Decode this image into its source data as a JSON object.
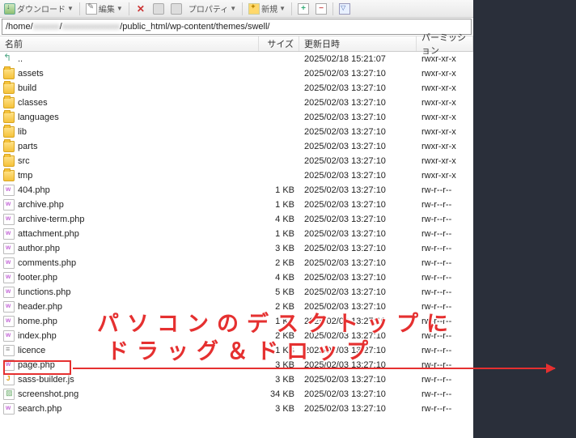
{
  "toolbar": {
    "download": "ダウンロード",
    "edit": "編集",
    "properties": "プロパティ",
    "new": "新規"
  },
  "path": {
    "prefix": "/home/",
    "blur1": "xxxxxx",
    "sep1": "/",
    "blur2": "xxxxxxxxxxxxx",
    "suffix": "/public_html/wp-content/themes/swell/"
  },
  "columns": {
    "name": "名前",
    "size": "サイズ",
    "date": "更新日時",
    "perm": "パーミッション"
  },
  "files": [
    {
      "icon": "up",
      "name": "..",
      "size": "",
      "date": "2025/02/18 15:21:07",
      "perm": "rwxr-xr-x"
    },
    {
      "icon": "folder",
      "name": "assets",
      "size": "",
      "date": "2025/02/03 13:27:10",
      "perm": "rwxr-xr-x"
    },
    {
      "icon": "folder",
      "name": "build",
      "size": "",
      "date": "2025/02/03 13:27:10",
      "perm": "rwxr-xr-x"
    },
    {
      "icon": "folder",
      "name": "classes",
      "size": "",
      "date": "2025/02/03 13:27:10",
      "perm": "rwxr-xr-x"
    },
    {
      "icon": "folder",
      "name": "languages",
      "size": "",
      "date": "2025/02/03 13:27:10",
      "perm": "rwxr-xr-x"
    },
    {
      "icon": "folder",
      "name": "lib",
      "size": "",
      "date": "2025/02/03 13:27:10",
      "perm": "rwxr-xr-x"
    },
    {
      "icon": "folder",
      "name": "parts",
      "size": "",
      "date": "2025/02/03 13:27:10",
      "perm": "rwxr-xr-x"
    },
    {
      "icon": "folder",
      "name": "src",
      "size": "",
      "date": "2025/02/03 13:27:10",
      "perm": "rwxr-xr-x"
    },
    {
      "icon": "folder",
      "name": "tmp",
      "size": "",
      "date": "2025/02/03 13:27:10",
      "perm": "rwxr-xr-x"
    },
    {
      "icon": "php",
      "name": "404.php",
      "size": "1 KB",
      "date": "2025/02/03 13:27:10",
      "perm": "rw-r--r--"
    },
    {
      "icon": "php",
      "name": "archive.php",
      "size": "1 KB",
      "date": "2025/02/03 13:27:10",
      "perm": "rw-r--r--"
    },
    {
      "icon": "php",
      "name": "archive-term.php",
      "size": "4 KB",
      "date": "2025/02/03 13:27:10",
      "perm": "rw-r--r--"
    },
    {
      "icon": "php",
      "name": "attachment.php",
      "size": "1 KB",
      "date": "2025/02/03 13:27:10",
      "perm": "rw-r--r--"
    },
    {
      "icon": "php",
      "name": "author.php",
      "size": "3 KB",
      "date": "2025/02/03 13:27:10",
      "perm": "rw-r--r--"
    },
    {
      "icon": "php",
      "name": "comments.php",
      "size": "2 KB",
      "date": "2025/02/03 13:27:10",
      "perm": "rw-r--r--"
    },
    {
      "icon": "php",
      "name": "footer.php",
      "size": "4 KB",
      "date": "2025/02/03 13:27:10",
      "perm": "rw-r--r--"
    },
    {
      "icon": "php",
      "name": "functions.php",
      "size": "5 KB",
      "date": "2025/02/03 13:27:10",
      "perm": "rw-r--r--"
    },
    {
      "icon": "php",
      "name": "header.php",
      "size": "2 KB",
      "date": "2025/02/03 13:27:10",
      "perm": "rw-r--r--"
    },
    {
      "icon": "php",
      "name": "home.php",
      "size": "1 KB",
      "date": "2025/02/03 13:27:10",
      "perm": "rw-r--r--"
    },
    {
      "icon": "php",
      "name": "index.php",
      "size": "2 KB",
      "date": "2025/02/03 13:27:10",
      "perm": "rw-r--r--"
    },
    {
      "icon": "txt",
      "name": "licence",
      "size": "1 KB",
      "date": "2025/02/03 13:27:10",
      "perm": "rw-r--r--"
    },
    {
      "icon": "php",
      "name": "page.php",
      "size": "3 KB",
      "date": "2025/02/03 13:27:10",
      "perm": "rw-r--r--"
    },
    {
      "icon": "js",
      "name": "sass-builder.js",
      "size": "3 KB",
      "date": "2025/02/03 13:27:10",
      "perm": "rw-r--r--"
    },
    {
      "icon": "png",
      "name": "screenshot.png",
      "size": "34 KB",
      "date": "2025/02/03 13:27:10",
      "perm": "rw-r--r--"
    },
    {
      "icon": "php",
      "name": "search.php",
      "size": "3 KB",
      "date": "2025/02/03 13:27:10",
      "perm": "rw-r--r--"
    }
  ],
  "overlay": {
    "line1": "パソコンのデスクトップに",
    "line2": "ドラッグ＆ドロップ"
  }
}
